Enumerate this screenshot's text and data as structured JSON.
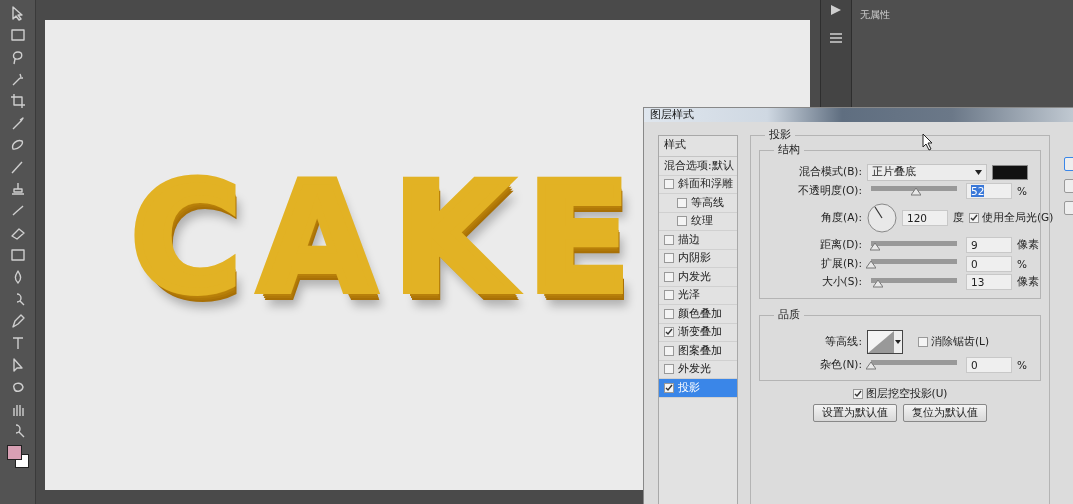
{
  "canvas": {
    "text": "CAKE"
  },
  "properties_panel": {
    "title": "无属性"
  },
  "dialog": {
    "title": "图层样式",
    "styles_header": "样式",
    "blend_options": "混合选项:默认",
    "styles": [
      {
        "label": "斜面和浮雕",
        "checked": false,
        "selected": false,
        "children": [
          {
            "label": "等高线",
            "checked": false,
            "selected": false
          },
          {
            "label": "纹理",
            "checked": false,
            "selected": false
          }
        ]
      },
      {
        "label": "描边",
        "checked": false,
        "selected": false
      },
      {
        "label": "内阴影",
        "checked": false,
        "selected": false
      },
      {
        "label": "内发光",
        "checked": false,
        "selected": false
      },
      {
        "label": "光泽",
        "checked": false,
        "selected": false
      },
      {
        "label": "颜色叠加",
        "checked": false,
        "selected": false
      },
      {
        "label": "渐变叠加",
        "checked": true,
        "selected": false
      },
      {
        "label": "图案叠加",
        "checked": false,
        "selected": false
      },
      {
        "label": "外发光",
        "checked": false,
        "selected": false
      },
      {
        "label": "投影",
        "checked": true,
        "selected": true
      }
    ],
    "section_title": "投影",
    "structure": {
      "title": "结构",
      "blend_mode": {
        "label": "混合模式(B):",
        "value": "正片叠底",
        "color": "#111111"
      },
      "opacity": {
        "label": "不透明度(O):",
        "level": 0.52,
        "value": "52",
        "value_selected": true,
        "unit": "%"
      },
      "angle": {
        "label": "角度(A):",
        "value": "120",
        "unit": "度",
        "global_light": {
          "label": "使用全局光(G)",
          "checked": true
        }
      },
      "sliders": [
        {
          "label": "距离(D):",
          "level": 0.05,
          "value": "9",
          "unit": "像素"
        },
        {
          "label": "扩展(R):",
          "level": 0,
          "value": "0",
          "unit": "%"
        },
        {
          "label": "大小(S):",
          "level": 0.08,
          "value": "13",
          "unit": "像素"
        }
      ]
    },
    "quality": {
      "title": "品质",
      "contour_label": "等高线:",
      "anti_alias": {
        "label": "消除锯齿(L)",
        "checked": false
      },
      "noise": {
        "label": "杂色(N):",
        "level": 0,
        "value": "0",
        "unit": "%"
      }
    },
    "knockout": {
      "label": "图层挖空投影(U)",
      "checked": true
    },
    "buttons": [
      "设置为默认值",
      "复位为默认值"
    ],
    "side_buttons": [
      {
        "selected": true
      },
      {
        "selected": false
      },
      {
        "selected": false
      }
    ]
  }
}
